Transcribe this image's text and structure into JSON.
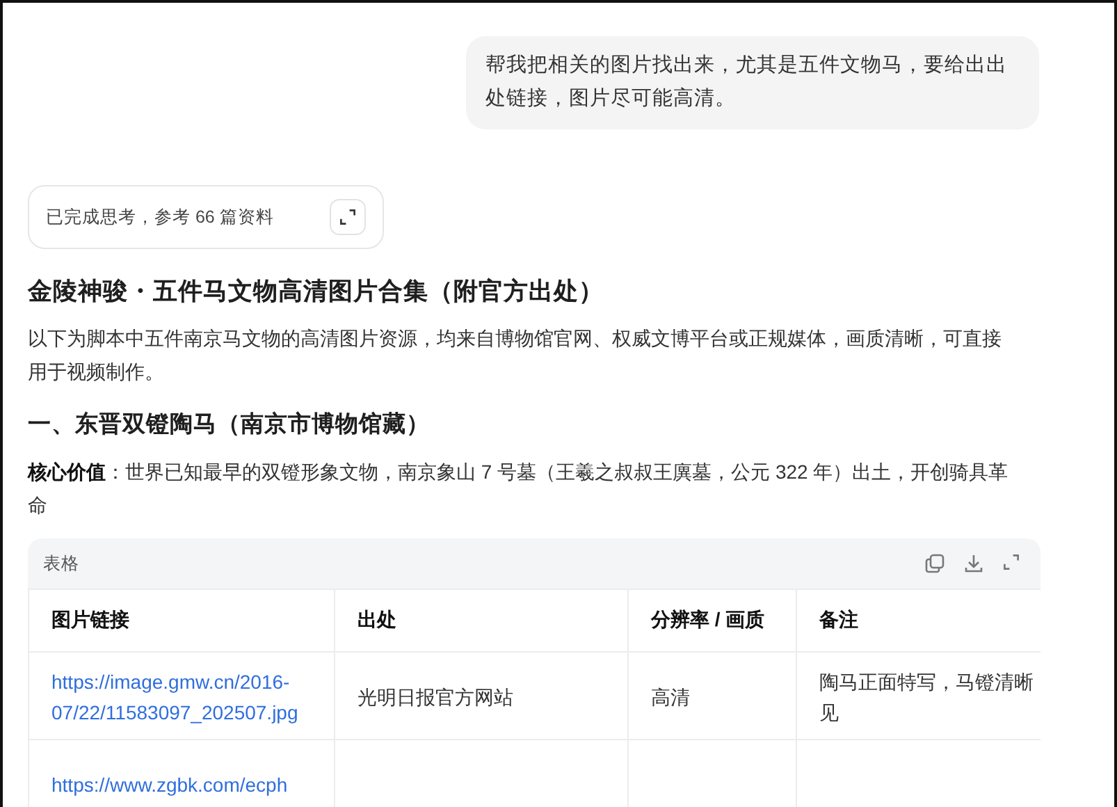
{
  "user_message": {
    "text": "帮我把相关的图片找出来，尤其是五件文物马，要给出出处链接，图片尽可能高清。"
  },
  "thinking": {
    "label": "已完成思考，参考 66 篇资料"
  },
  "title": "金陵神骏・五件马文物高清图片合集（附官方出处）",
  "intro": "以下为脚本中五件南京马文物的高清图片资源，均来自博物馆官网、权威文博平台或正规媒体，画质清晰，可直接用于视频制作。",
  "section_heading": "一、东晋双镫陶马（南京市博物馆藏）",
  "core_value": "**核心价值**：世界已知最早的双镫形象文物，南京象山 7 号墓（王羲之叔叔王廙墓，公元 322 年）出土，开创骑具革命",
  "table": {
    "label": "表格",
    "columns": [
      "图片链接",
      "出处",
      "分辨率 / 画质",
      "备注"
    ],
    "rows": [
      {
        "cells": [
          {
            "kind": "link",
            "lines": [
              "https://image.gmw.cn/2016-07/22/11583097_202507.jpg"
            ]
          },
          {
            "kind": "text",
            "lines": [
              "光明日报官方网站"
            ]
          },
          {
            "kind": "text",
            "lines": [
              "高清"
            ]
          },
          {
            "kind": "text",
            "lines": [
              "陶马正面特写，马镫清晰",
              "见"
            ]
          }
        ]
      },
      {
        "cells": [
          {
            "kind": "link",
            "lines": [
              "https://www.zgbk.com/ecph"
            ]
          },
          {
            "kind": "empty"
          },
          {
            "kind": "empty"
          },
          {
            "kind": "empty"
          }
        ]
      }
    ]
  }
}
